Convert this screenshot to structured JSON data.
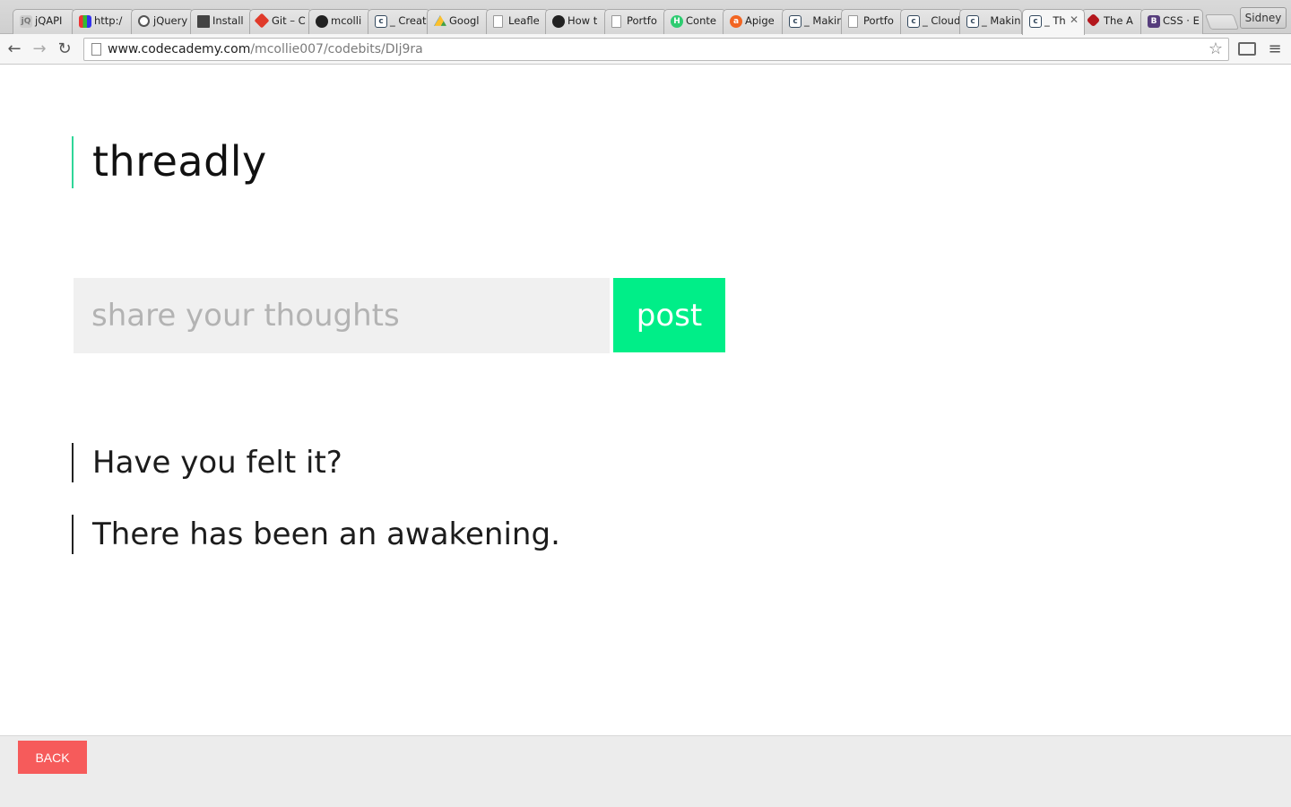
{
  "browser": {
    "tabs": [
      {
        "label": "jQAPI",
        "icon": "jqapi-icon"
      },
      {
        "label": "http:/",
        "icon": "colorbars-icon"
      },
      {
        "label": "jQuery",
        "icon": "jquery-icon"
      },
      {
        "label": "Install",
        "icon": "terminal-icon"
      },
      {
        "label": "Git – C",
        "icon": "git-icon"
      },
      {
        "label": "mcolli",
        "icon": "github-icon"
      },
      {
        "label": "_ Creati",
        "icon": "codecademy-icon"
      },
      {
        "label": "Googl",
        "icon": "google-drive-icon"
      },
      {
        "label": "Leafle",
        "icon": "page-icon"
      },
      {
        "label": "How t",
        "icon": "github-icon"
      },
      {
        "label": "Portfo",
        "icon": "page-icon"
      },
      {
        "label": "Conte",
        "icon": "hubspot-icon"
      },
      {
        "label": "Apige",
        "icon": "apigee-icon"
      },
      {
        "label": "_ Makin",
        "icon": "codecademy-icon"
      },
      {
        "label": "Portfo",
        "icon": "page-icon"
      },
      {
        "label": "_ Cloud",
        "icon": "codecademy-icon"
      },
      {
        "label": "_ Makin",
        "icon": "codecademy-icon"
      },
      {
        "label": "_ Th",
        "icon": "codecademy-icon"
      },
      {
        "label": "The A",
        "icon": "ruby-icon"
      },
      {
        "label": "CSS · E",
        "icon": "bootstrap-icon"
      }
    ],
    "active_tab_index": 17,
    "profile_name": "Sidney",
    "url_host": "www.codecademy.com",
    "url_path": "/mcollie007/codebits/DIj9ra"
  },
  "app": {
    "brand": "threadly",
    "input_placeholder": "share your thoughts",
    "input_value": "",
    "post_label": "post",
    "posts": [
      "Have you felt it?",
      "There has been an awakening."
    ],
    "accent_color": "#00ee88",
    "back_label": "BACK",
    "back_color": "#f65b5b"
  }
}
